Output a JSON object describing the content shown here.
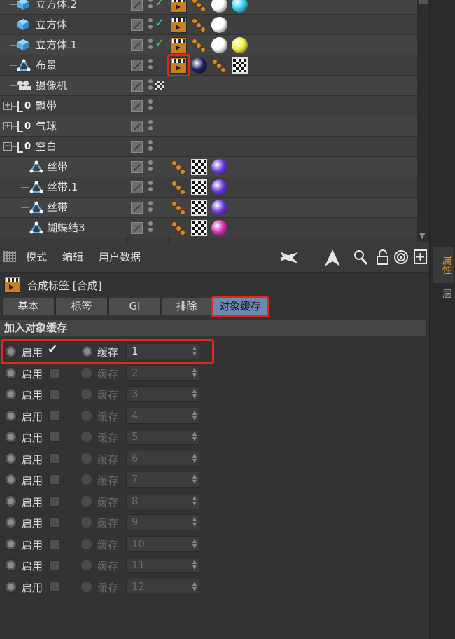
{
  "object_manager": {
    "rows": [
      {
        "name": "立方体.2",
        "icon": "cube-icon",
        "check": true,
        "tags": [
          {
            "t": "clap"
          },
          {
            "t": "phong"
          },
          {
            "t": "ball",
            "c": "#ffffff"
          },
          {
            "t": "ball",
            "c": "#3ad0f0"
          }
        ]
      },
      {
        "name": "立方体",
        "icon": "cube-icon",
        "check": true,
        "tags": [
          {
            "t": "clap"
          },
          {
            "t": "phong"
          },
          {
            "t": "ball",
            "c": "#ffffff"
          }
        ]
      },
      {
        "name": "立方体.1",
        "icon": "cube-icon",
        "check": true,
        "tags": [
          {
            "t": "clap"
          },
          {
            "t": "phong"
          },
          {
            "t": "ball",
            "c": "#ffffff"
          },
          {
            "t": "ball",
            "c": "#f0f040"
          }
        ]
      },
      {
        "name": "布景",
        "icon": "polygon-object-icon",
        "check": false,
        "tags": [
          {
            "t": "clap",
            "selected": true
          },
          {
            "t": "ball",
            "c": "#1a1e5c"
          },
          {
            "t": "phong"
          },
          {
            "t": "check"
          }
        ]
      },
      {
        "name": "摄像机",
        "icon": "camera-icon",
        "check": false,
        "camtag": true,
        "tags": []
      },
      {
        "name": "飘带",
        "icon": "null-object-icon",
        "check": false,
        "tags": []
      },
      {
        "name": "气球",
        "icon": "null-object-icon",
        "check": false,
        "tags": []
      },
      {
        "name": "空白",
        "icon": "null-object-icon",
        "check": false,
        "tags": []
      },
      {
        "name": "丝带",
        "icon": "polygon-object-icon",
        "check": false,
        "tags": [
          {
            "t": "phong"
          },
          {
            "t": "check"
          },
          {
            "t": "ball",
            "c": "#6a3ad8"
          }
        ]
      },
      {
        "name": "丝带.1",
        "icon": "polygon-object-icon",
        "check": false,
        "tags": [
          {
            "t": "phong"
          },
          {
            "t": "check"
          },
          {
            "t": "ball",
            "c": "#6a3ad8"
          }
        ]
      },
      {
        "name": "丝带",
        "icon": "polygon-object-icon",
        "check": false,
        "tags": [
          {
            "t": "phong"
          },
          {
            "t": "check"
          },
          {
            "t": "ball",
            "c": "#6a3ad8"
          }
        ]
      },
      {
        "name": "蝴蝶结3",
        "icon": "polygon-object-icon",
        "check": false,
        "tags": [
          {
            "t": "phong"
          },
          {
            "t": "check"
          },
          {
            "t": "ball",
            "c": "#d030b0"
          }
        ]
      }
    ]
  },
  "right_panel": {
    "tab_attributes": "属性",
    "tab_layers": "层"
  },
  "attribute_manager": {
    "menu": {
      "mode": "模式",
      "edit": "编辑",
      "user_data": "用户数据"
    },
    "toolbar_icons": [
      "back-arrow-icon",
      "up-arrow-icon",
      "search-icon",
      "lock-icon",
      "target-icon",
      "new-panel-icon"
    ],
    "title": "合成标签 [合成]",
    "tabs": [
      "基本",
      "标签",
      "GI",
      "排除",
      "对象缓存"
    ],
    "active_tab": "对象缓存",
    "section": "加入对象缓存",
    "enable_label": "启用",
    "buffer_label": "缓存",
    "rows": [
      {
        "enabled": true,
        "value": "1"
      },
      {
        "enabled": false,
        "value": "2"
      },
      {
        "enabled": false,
        "value": "3"
      },
      {
        "enabled": false,
        "value": "4"
      },
      {
        "enabled": false,
        "value": "5"
      },
      {
        "enabled": false,
        "value": "6"
      },
      {
        "enabled": false,
        "value": "7"
      },
      {
        "enabled": false,
        "value": "8"
      },
      {
        "enabled": false,
        "value": "9"
      },
      {
        "enabled": false,
        "value": "10"
      },
      {
        "enabled": false,
        "value": "11"
      },
      {
        "enabled": false,
        "value": "12"
      }
    ],
    "colors": {
      "highlight": "#e0281c",
      "active_tab": "#6c8ab0",
      "attr_tab": "#f0a020"
    }
  }
}
